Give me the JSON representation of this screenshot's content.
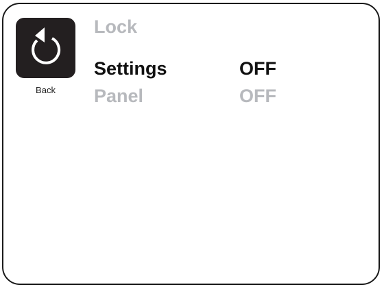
{
  "header": {
    "title": "Lock",
    "back": {
      "label": "Back",
      "icon": "back-arrow-icon"
    }
  },
  "menu": {
    "items": [
      {
        "label": "Settings",
        "value": "OFF",
        "state": "selected"
      },
      {
        "label": "Panel",
        "value": "OFF",
        "state": "dim"
      }
    ]
  },
  "colors": {
    "dim_text": "#b7b9bd",
    "active_text": "#111111",
    "button_bg": "#231f20"
  }
}
